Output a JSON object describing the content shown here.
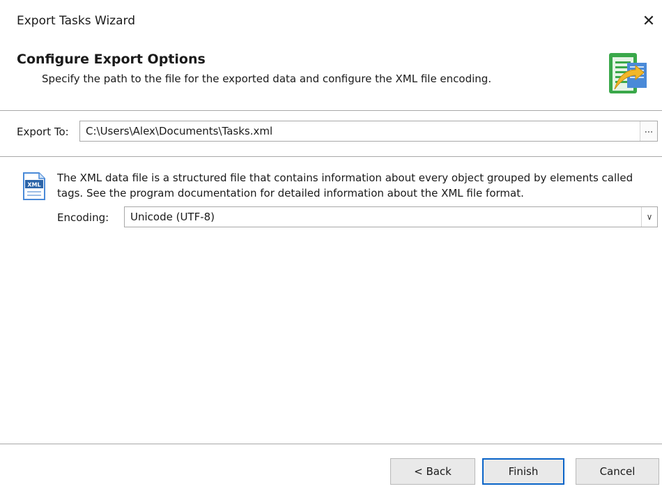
{
  "window": {
    "title": "Export Tasks Wizard",
    "close_glyph": "✕"
  },
  "header": {
    "title": "Configure Export Options",
    "subtitle": "Specify the path to the file for the exported data and configure the XML file encoding.",
    "icon": "export-document-icon"
  },
  "export": {
    "label": "Export To:",
    "value": "C:\\Users\\Alex\\Documents\\Tasks.xml",
    "browse_label": "..."
  },
  "info": {
    "icon": "xml-file-icon",
    "icon_text": "XML",
    "text": "The XML data file is a structured file that contains information about every object grouped by elements called tags. See the program documentation for detailed information about the XML file format."
  },
  "encoding": {
    "label": "Encoding:",
    "selected": "Unicode (UTF-8)"
  },
  "buttons": {
    "back": "< Back",
    "finish": "Finish",
    "cancel": "Cancel"
  },
  "colors": {
    "accent": "#0a64c8",
    "separator": "#a8a8a8",
    "button_bg": "#e9e9e9",
    "icon_green": "#3aa84a",
    "icon_yellow": "#f2b72a",
    "icon_blue": "#4a8ad8"
  }
}
